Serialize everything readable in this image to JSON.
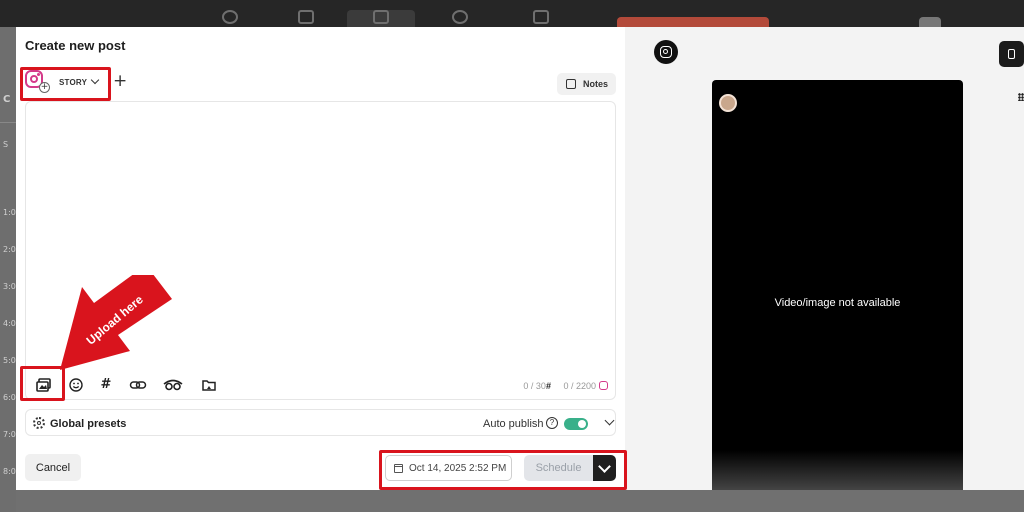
{
  "modal": {
    "title": "Create new post",
    "post_type": "STORY",
    "add_account": "+",
    "notes_label": "Notes",
    "editor_placeholder": "",
    "toolbar_icons": [
      "media-upload-icon",
      "emoji-icon",
      "hashtag-icon",
      "link-icon",
      "ai-assistant-icon",
      "media-library-icon"
    ],
    "hashtag_symbol": "#",
    "hashtag_count": "0 / 30",
    "char_count": "0 / 2200",
    "presets_label": "Global presets",
    "auto_publish_label": "Auto publish",
    "auto_publish_enabled": true,
    "cancel_label": "Cancel",
    "schedule_date": "Oct 14, 2025 2:52 PM",
    "schedule_label": "Schedule"
  },
  "annotation": {
    "arrow_text": "Upload here",
    "color": "#d9141d"
  },
  "preview": {
    "network_icon": "instagram-icon",
    "device_icon": "mobile-icon",
    "message": "Video/image not available"
  },
  "background": {
    "time_labels": [
      "1:0",
      "2:0",
      "3:0",
      "4:0",
      "5:0",
      "6:0",
      "7:0",
      "8:0"
    ],
    "side_letters": [
      "C",
      "S"
    ]
  },
  "colors": {
    "instagram": "#d43a8a",
    "toggle_on": "#39b08a",
    "annotation_red": "#d9141d"
  }
}
